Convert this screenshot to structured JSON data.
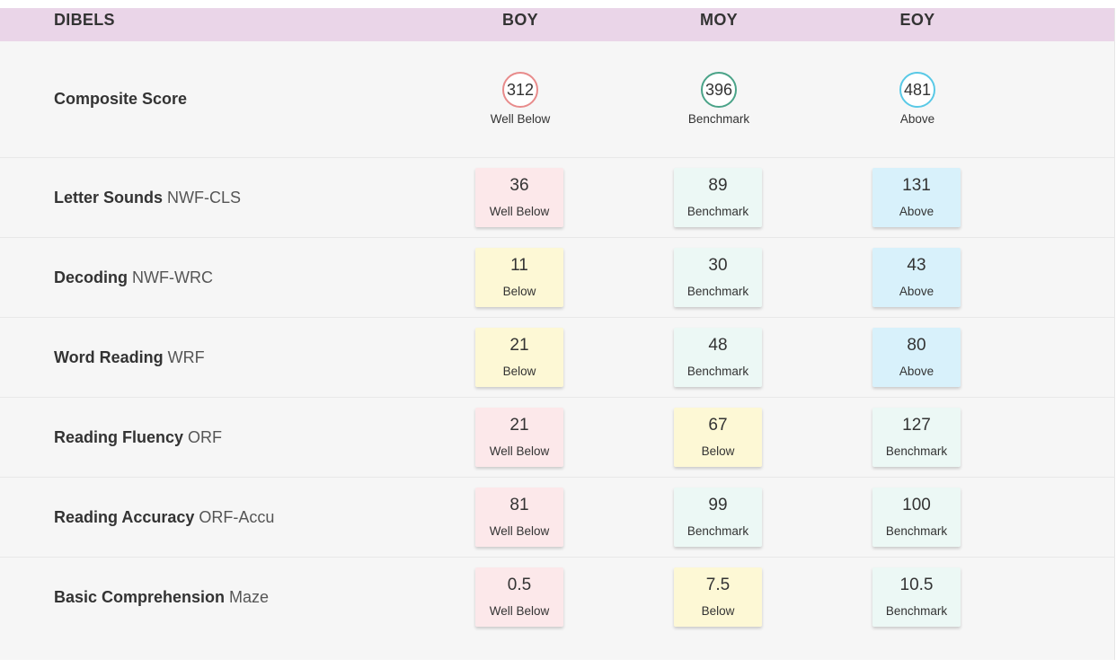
{
  "header": {
    "title": "DIBELS",
    "columns": [
      "BOY",
      "MOY",
      "EOY"
    ]
  },
  "composite": {
    "label": "Composite Score",
    "scores": [
      {
        "value": "312",
        "level": "Well Below",
        "color": "#e88b8b"
      },
      {
        "value": "396",
        "level": "Benchmark",
        "color": "#4aa388"
      },
      {
        "value": "481",
        "level": "Above",
        "color": "#59c9e6"
      }
    ]
  },
  "rows": [
    {
      "label": "Letter Sounds",
      "code": "NWF-CLS",
      "cells": [
        {
          "value": "36",
          "level": "Well Below"
        },
        {
          "value": "89",
          "level": "Benchmark"
        },
        {
          "value": "131",
          "level": "Above"
        }
      ]
    },
    {
      "label": "Decoding",
      "code": "NWF-WRC",
      "cells": [
        {
          "value": "11",
          "level": "Below"
        },
        {
          "value": "30",
          "level": "Benchmark"
        },
        {
          "value": "43",
          "level": "Above"
        }
      ]
    },
    {
      "label": "Word Reading",
      "code": "WRF",
      "cells": [
        {
          "value": "21",
          "level": "Below"
        },
        {
          "value": "48",
          "level": "Benchmark"
        },
        {
          "value": "80",
          "level": "Above"
        }
      ]
    },
    {
      "label": "Reading Fluency",
      "code": "ORF",
      "cells": [
        {
          "value": "21",
          "level": "Well Below"
        },
        {
          "value": "67",
          "level": "Below"
        },
        {
          "value": "127",
          "level": "Benchmark"
        }
      ]
    },
    {
      "label": "Reading Accuracy",
      "code": "ORF-Accu",
      "cells": [
        {
          "value": "81",
          "level": "Well Below"
        },
        {
          "value": "99",
          "level": "Benchmark"
        },
        {
          "value": "100",
          "level": "Benchmark"
        }
      ]
    },
    {
      "label": "Basic Comprehension",
      "code": "Maze",
      "cells": [
        {
          "value": "0.5",
          "level": "Well Below"
        },
        {
          "value": "7.5",
          "level": "Below"
        },
        {
          "value": "10.5",
          "level": "Benchmark"
        }
      ]
    }
  ],
  "level_colors": {
    "Well Below": "#fce8ea",
    "Below": "#fdf8d5",
    "Benchmark": "#ecf8f5",
    "Above": "#d8f1fb"
  }
}
